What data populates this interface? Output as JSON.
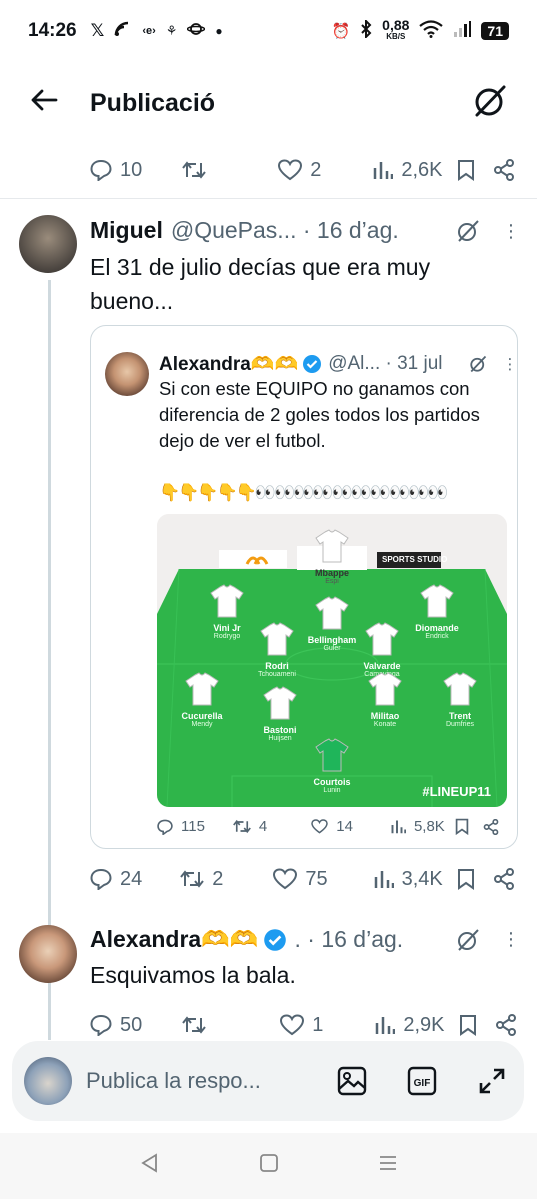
{
  "status": {
    "time": "14:26",
    "net_speed_value": "0,88",
    "net_speed_unit": "KB/S",
    "battery": "71"
  },
  "header": {
    "title": "Publicació"
  },
  "top_actions": {
    "replies": "10",
    "reposts": "",
    "likes": "2",
    "views": "2,6K"
  },
  "tweet1": {
    "name": "Miguel",
    "meta": "@QuePas... · 16 d’ag.",
    "text": "El 31 de julio decías que era muy bueno...",
    "actions": {
      "replies": "24",
      "reposts": "2",
      "likes": "75",
      "views": "3,4K"
    }
  },
  "quote": {
    "name": "Alexandra🫶🫶",
    "meta": "@Al... · 31 jul",
    "text": "Si con este EQUIPO no ganamos con diferencia de 2 goles todos los partidos dejo de ver el futbol.",
    "emojis": "👇👇👇👇👇👀👀👀👀👀👀👀👀👀👀",
    "actions": {
      "replies": "115",
      "reposts": "4",
      "likes": "14",
      "views": "5,8K"
    },
    "lineup": {
      "brand": "SPORTS STUDIO",
      "tag": "#LINEUP11",
      "players": [
        {
          "name": "Mbappe",
          "sub": "Espi"
        },
        {
          "name": "Vini Jr",
          "sub": "Rodrygo"
        },
        {
          "name": "Bellingham",
          "sub": "Guler"
        },
        {
          "name": "Diomande",
          "sub": "Endrick"
        },
        {
          "name": "Rodri",
          "sub": "Tchouameni"
        },
        {
          "name": "Valvarde",
          "sub": "Camavinga"
        },
        {
          "name": "Cucurella",
          "sub": "Mendy"
        },
        {
          "name": "Bastoni",
          "sub": "Huijsen"
        },
        {
          "name": "Militao",
          "sub": "Konate"
        },
        {
          "name": "Trent",
          "sub": "Dumfries"
        },
        {
          "name": "Courtois",
          "sub": "Lunin"
        }
      ]
    }
  },
  "tweet2": {
    "name": "Alexandra🫶🫶",
    "meta": ". · 16 d’ag.",
    "text": "Esquivamos la bala.",
    "actions": {
      "replies": "50",
      "reposts": "",
      "likes": "1",
      "views": "2,9K"
    }
  },
  "reply_bar": {
    "placeholder": "Publica la respo..."
  },
  "colors": {
    "accent": "#1d9bf0",
    "pitch": "#2fb54a",
    "muted": "#536471"
  }
}
